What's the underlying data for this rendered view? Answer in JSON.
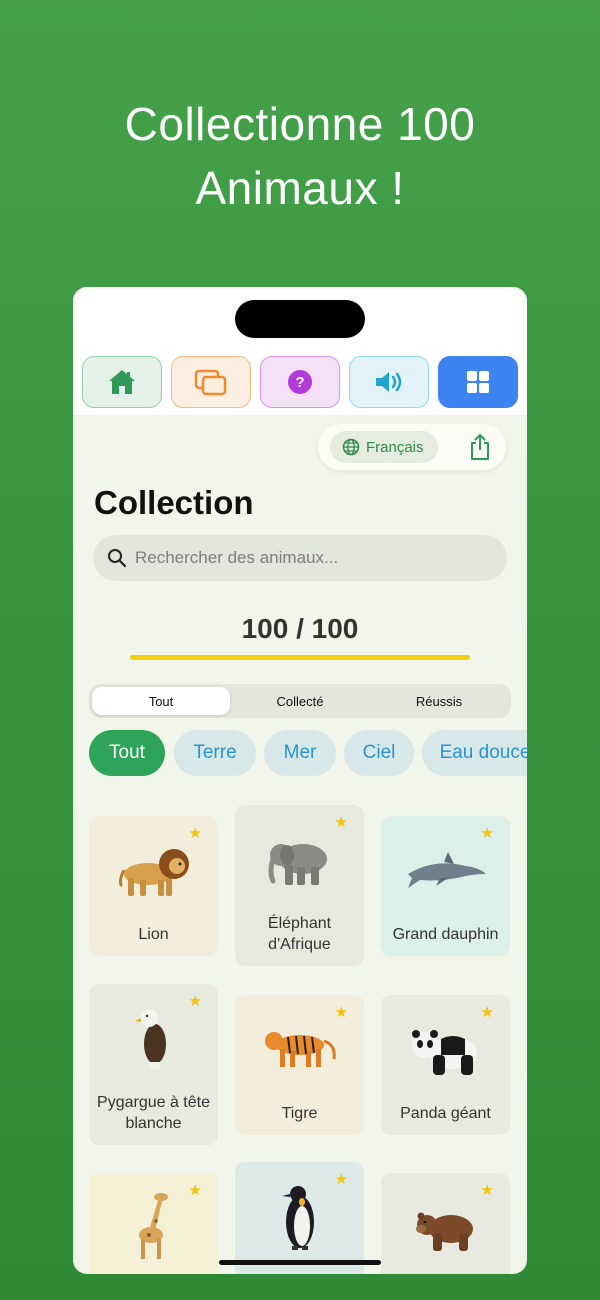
{
  "headline": {
    "line1": "Collectionne 100",
    "line2": "Animaux !"
  },
  "navbar": {
    "items": [
      {
        "name": "home",
        "icon": "house-icon",
        "color": "#2f9a57",
        "bg": "#e3f1e9",
        "border": "#8fd0aa"
      },
      {
        "name": "cards",
        "icon": "cards-icon",
        "color": "#f08a2a",
        "bg": "#fdeee2",
        "border": "#f7b783"
      },
      {
        "name": "quiz",
        "icon": "question-icon",
        "color": "#b23bd8",
        "bg": "#f4e1f8",
        "border": "#d694ea"
      },
      {
        "name": "sound",
        "icon": "speaker-icon",
        "color": "#22a3cf",
        "bg": "#e2f4fa",
        "border": "#8fd6ee"
      },
      {
        "name": "collection",
        "icon": "grid-icon",
        "color": "#ffffff",
        "bg": "#3d83f2",
        "border": "#3d83f2"
      }
    ]
  },
  "language": {
    "label": "Français"
  },
  "page": {
    "title": "Collection"
  },
  "search": {
    "placeholder": "Rechercher des animaux..."
  },
  "progress": {
    "label": "100 / 100",
    "fraction": 1.0
  },
  "segments": {
    "items": [
      "Tout",
      "Collecté",
      "Réussis"
    ],
    "active": 0
  },
  "filters": {
    "items": [
      "Tout",
      "Terre",
      "Mer",
      "Ciel",
      "Eau douce"
    ],
    "active": 0
  },
  "animals": [
    {
      "name": "Lion",
      "icon": "lion-icon",
      "bg": "#f3eedb"
    },
    {
      "name": "Éléphant d'Afrique",
      "icon": "elephant-icon",
      "bg": "#e7e9df"
    },
    {
      "name": "Grand dauphin",
      "icon": "dolphin-icon",
      "bg": "#daf0e9"
    },
    {
      "name": "Pygargue à tête blanche",
      "icon": "eagle-icon",
      "bg": "#e8e9df"
    },
    {
      "name": "Tigre",
      "icon": "tiger-icon",
      "bg": "#f3eedb"
    },
    {
      "name": "Panda géant",
      "icon": "panda-icon",
      "bg": "#e8e9df"
    },
    {
      "name": "",
      "icon": "giraffe-icon",
      "bg": "#f4f1d6"
    },
    {
      "name": "",
      "icon": "penguin-icon",
      "bg": "#dde9e7"
    },
    {
      "name": "",
      "icon": "bear-icon",
      "bg": "#e8e9df"
    }
  ]
}
